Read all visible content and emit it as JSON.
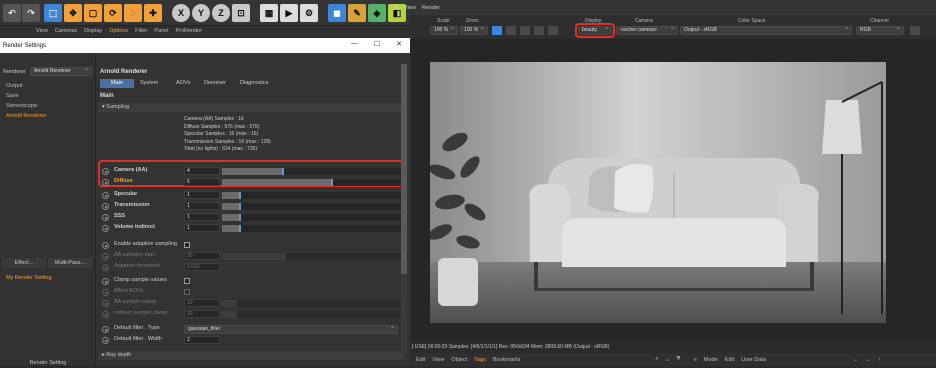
{
  "toolbar": {
    "icons": [
      "undo-icon",
      "redo-icon",
      "select-icon",
      "move-icon",
      "scale-icon",
      "rotate-icon",
      "add-icon",
      "x-axis-icon",
      "y-axis-icon",
      "z-axis-icon",
      "coordinate-icon",
      "render-view-icon",
      "render-picture-queue-icon",
      "render-settings-icon",
      "cube-icon",
      "pen-icon",
      "subdivision-icon",
      "deformer-icon",
      "gear-icon"
    ],
    "axis_x": "X",
    "axis_y": "Y",
    "axis_z": "Z",
    "accent_orange": "#f2a13a",
    "accent_blue": "#3f86d8"
  },
  "menubar": {
    "items": [
      "View",
      "Cameras",
      "Display",
      "Options",
      "Filter",
      "Panel",
      "ProRender"
    ],
    "active": "Options"
  },
  "viewport_menu": {
    "items": [
      "View",
      "Render"
    ]
  },
  "viewport_controls": {
    "scale_label": "Scale",
    "scale_value": "100 %",
    "zoom_label": "Zoom",
    "zoom_value": "100 %",
    "display_label": "Display",
    "display_value": "beauty",
    "camera_label": "Camera",
    "camera_value": "<active camera>",
    "colorspace_label": "Color Space",
    "colorspace_value": "Output - sRGB",
    "channel_label": "Channel",
    "channel_value": "RGB"
  },
  "render_settings": {
    "title": "Render Settings",
    "window_buttons": [
      "—",
      "☐",
      "✕"
    ],
    "renderer_label": "Renderer",
    "renderer_value": "Arnold Renderer",
    "tree": [
      "Output",
      "Save",
      "Stereoscopic",
      "Arnold Renderer"
    ],
    "effect_button": "Effect...",
    "multipass_button": "Multi-Pass...",
    "my_render_setting": "My Render Setting",
    "bottom_button": "Render Setting",
    "panel_title": "Arnold Renderer",
    "tabs": [
      "Main",
      "System",
      "AOVs",
      "Denoiser",
      "Diagnostics"
    ],
    "active_tab": "Main",
    "section_main": "Main",
    "group_sampling": "Sampling",
    "info": [
      "Camera (AA) Samples : 16",
      "Diffuse Samples : 576 (max : 576)",
      "Specular Samples : 16 (max : 16)",
      "Transmission Samples : 16 (max : 128)",
      "Total (no lights) : 624 (max : 736)"
    ],
    "params": [
      {
        "name": "Camera (AA)",
        "value": "4",
        "fill": 0.33
      },
      {
        "name": "Diffuse",
        "value": "6",
        "fill": 0.6
      },
      {
        "name": "Specular",
        "value": "1",
        "fill": 0.1
      },
      {
        "name": "Transmission",
        "value": "1",
        "fill": 0.1
      },
      {
        "name": "SSS",
        "value": "1",
        "fill": 0.1
      },
      {
        "name": "Volume indirect",
        "value": "1",
        "fill": 0.1
      }
    ],
    "adaptive_label": "Enable adaptive sampling",
    "aa_max_label": "AA samples max",
    "aa_max_value": "20",
    "adaptive_thresh_label": "Adaptive threshold",
    "adaptive_thresh_value": "0.015",
    "clamp_label": "Clamp sample values",
    "affect_aovs_label": "Affect AOVs",
    "aa_clamp_label": "AA sample clamp",
    "aa_clamp_value": "10",
    "indirect_clamp_label": "Indirect sample clamp",
    "indirect_clamp_value": "10",
    "filter_type_label": "Default filter . Type",
    "filter_type_value": "gaussian_filter",
    "filter_width_label": "Default filter . Width",
    "filter_width_value": "2",
    "ray_depth_label": "Ray depth"
  },
  "viewport": {
    "status": "[ USE] 00:00:29  Samples: [4/6/1/1/1/1]  Res: 950x534  Mem: 2808.50 MB  (Output - sRGB)"
  },
  "bottombar": {
    "items": [
      "Edit",
      "View",
      "Object",
      "Tags",
      "Bookmarks"
    ],
    "right_items": [
      "Mode",
      "Edit",
      "User Data"
    ]
  }
}
